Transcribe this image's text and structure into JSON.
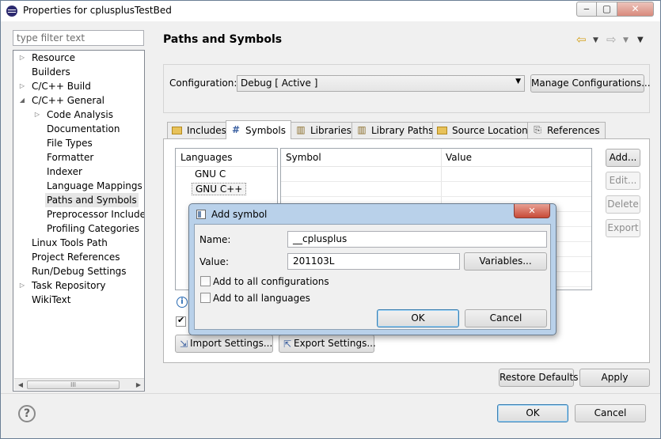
{
  "window": {
    "title": "Properties for cplusplusTestBed"
  },
  "filter": {
    "placeholder": "type filter text"
  },
  "tree": {
    "items": [
      {
        "label": "Resource"
      },
      {
        "label": "Builders"
      },
      {
        "label": "C/C++ Build"
      },
      {
        "label": "C/C++ General"
      },
      {
        "label": "Code Analysis"
      },
      {
        "label": "Documentation"
      },
      {
        "label": "File Types"
      },
      {
        "label": "Formatter"
      },
      {
        "label": "Indexer"
      },
      {
        "label": "Language Mappings"
      },
      {
        "label": "Paths and Symbols"
      },
      {
        "label": "Preprocessor Include Pa"
      },
      {
        "label": "Profiling Categories"
      },
      {
        "label": "Linux Tools Path"
      },
      {
        "label": "Project References"
      },
      {
        "label": "Run/Debug Settings"
      },
      {
        "label": "Task Repository"
      },
      {
        "label": "WikiText"
      }
    ],
    "scroll_thumb": "III"
  },
  "page": {
    "title": "Paths and Symbols"
  },
  "config": {
    "label": "Configuration:",
    "selected": "Debug  [ Active ]",
    "manage_button": "Manage Configurations..."
  },
  "tabs": [
    {
      "label": "Includes",
      "icon": "folder-icon"
    },
    {
      "label": "Symbols",
      "icon": "hash-icon"
    },
    {
      "label": "Libraries",
      "icon": "library-icon"
    },
    {
      "label": "Library Paths",
      "icon": "library-path-icon"
    },
    {
      "label": "Source Location",
      "icon": "source-folder-icon"
    },
    {
      "label": "References",
      "icon": "references-icon"
    }
  ],
  "languages": {
    "header": "Languages",
    "items": [
      "GNU C",
      "GNU C++"
    ]
  },
  "symbols_table": {
    "headers": [
      "Symbol",
      "Value"
    ]
  },
  "side_buttons": {
    "add": "Add...",
    "edit": "Edit...",
    "delete": "Delete",
    "export": "Export"
  },
  "bottom_buttons": {
    "import": "Import Settings...",
    "export": "Export Settings...",
    "restore": "Restore Defaults",
    "apply": "Apply",
    "ok": "OK",
    "cancel": "Cancel"
  },
  "dialog": {
    "title": "Add symbol",
    "name_label": "Name:",
    "name_value": "__cplusplus",
    "value_label": "Value:",
    "value_value": "201103L",
    "variables_button": "Variables...",
    "all_configs_label": "Add to all configurations",
    "all_langs_label": "Add to all languages",
    "ok": "OK",
    "cancel": "Cancel"
  },
  "colors": {
    "dialog_frame": "#b9d1ea",
    "close_button": "#c74b38",
    "default_button_border": "#3c7fb1"
  }
}
